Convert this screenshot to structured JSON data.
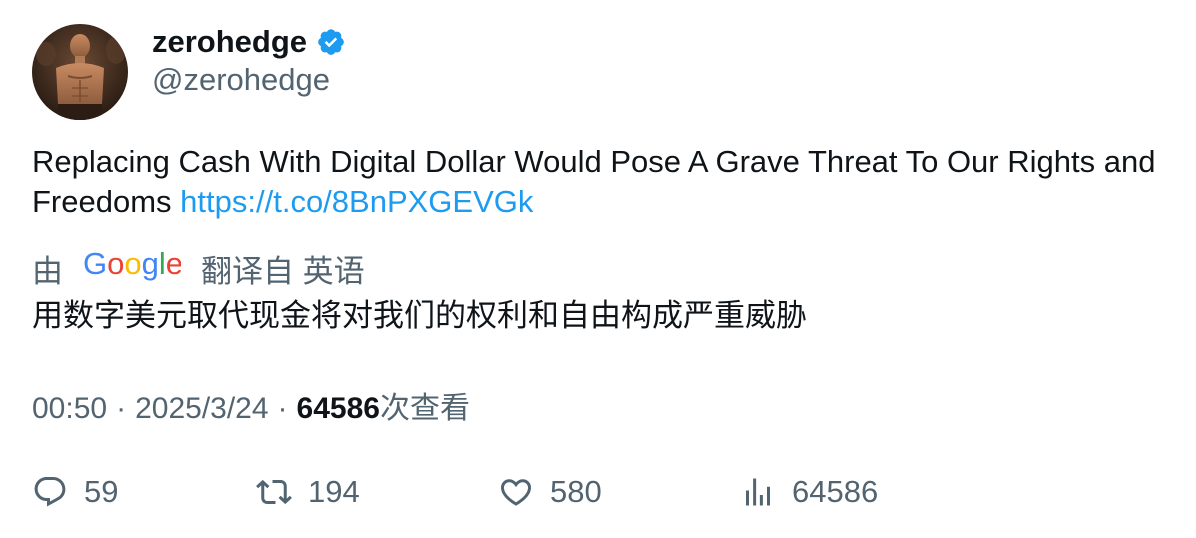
{
  "author": {
    "display_name": "zerohedge",
    "handle": "@zerohedge",
    "verified": true
  },
  "tweet": {
    "text": "Replacing Cash With Digital Dollar Would Pose A Grave Threat To Our Rights and Freedoms ",
    "link": "https://t.co/8BnPXGEVGk"
  },
  "translation": {
    "prefix": "由",
    "provider": "Google",
    "suffix": "翻译自 英语",
    "text": "用数字美元取代现金将对我们的权利和自由构成严重威胁"
  },
  "meta": {
    "time": "00:50",
    "separator": "·",
    "date": "2025/3/24",
    "views_count": "64586",
    "views_label": "次查看"
  },
  "actions": {
    "replies": "59",
    "retweets": "194",
    "likes": "580",
    "views": "64586"
  },
  "colors": {
    "link": "#1d9bf0",
    "secondary_text": "#536471",
    "primary_text": "#0f1419",
    "verified_badge": "#1d9bf0"
  }
}
